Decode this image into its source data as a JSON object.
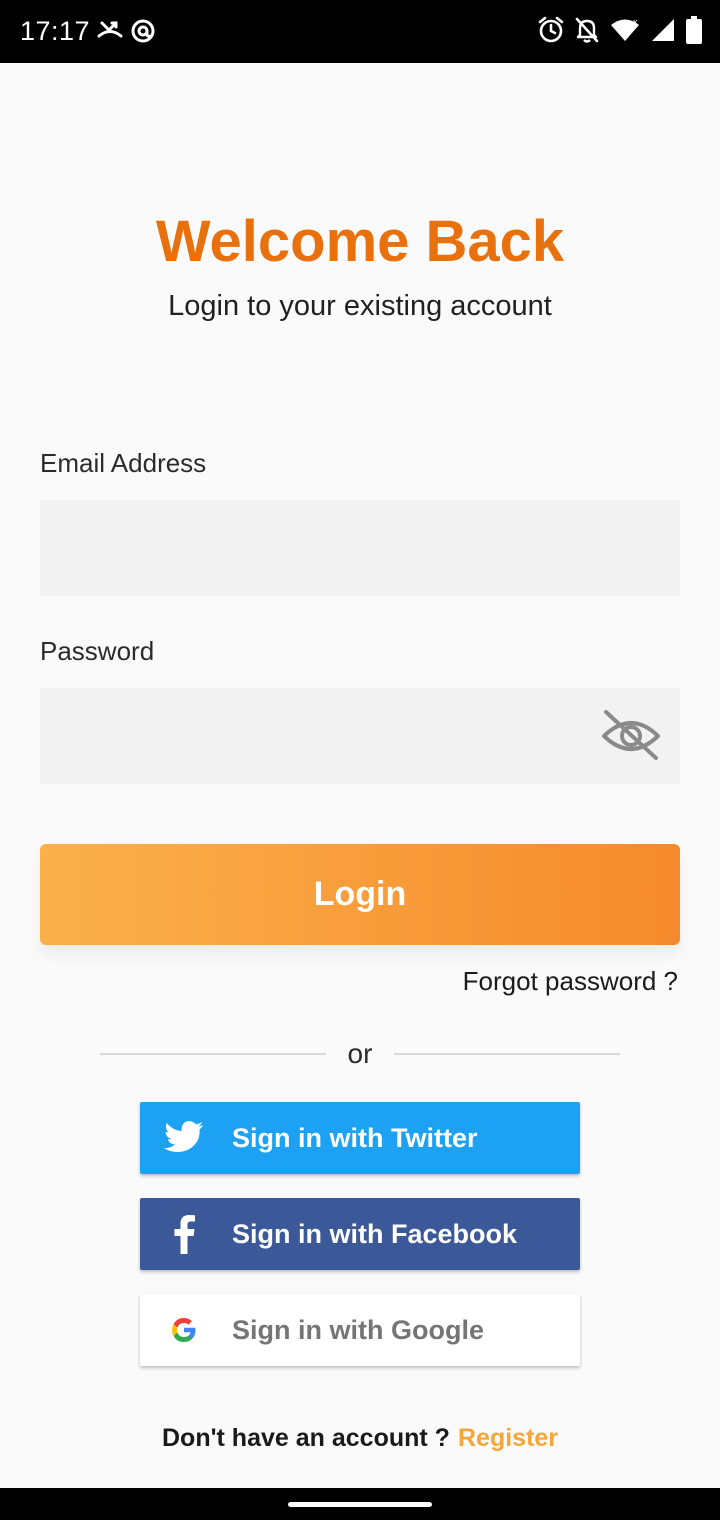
{
  "status_bar": {
    "time": "17:17",
    "left_icons": [
      "missed-call-icon",
      "at-sign-icon"
    ],
    "right_icons": [
      "alarm-icon",
      "notifications-off-icon",
      "wifi-icon",
      "signal-icon",
      "battery-icon"
    ]
  },
  "header": {
    "title": "Welcome Back",
    "subtitle": "Login to your existing account"
  },
  "form": {
    "email": {
      "label": "Email Address",
      "value": "",
      "placeholder": ""
    },
    "password": {
      "label": "Password",
      "value": "",
      "placeholder": "",
      "toggle_icon": "visibility-off-icon"
    }
  },
  "actions": {
    "login_label": "Login",
    "forgot_label": "Forgot password ?",
    "divider_label": "or"
  },
  "social": {
    "twitter_label": "Sign in with Twitter",
    "facebook_label": "Sign in with Facebook",
    "google_label": "Sign in with Google"
  },
  "footer": {
    "prompt": "Don't have an account ?",
    "register_label": "Register"
  },
  "colors": {
    "title": "#e8710e",
    "login_gradient_start": "#fbb14a",
    "login_gradient_end": "#f58a2c",
    "twitter": "#1da1f2",
    "facebook": "#3b5998",
    "google_bg": "#ffffff",
    "google_text": "#757575",
    "register": "#f5a53a"
  }
}
